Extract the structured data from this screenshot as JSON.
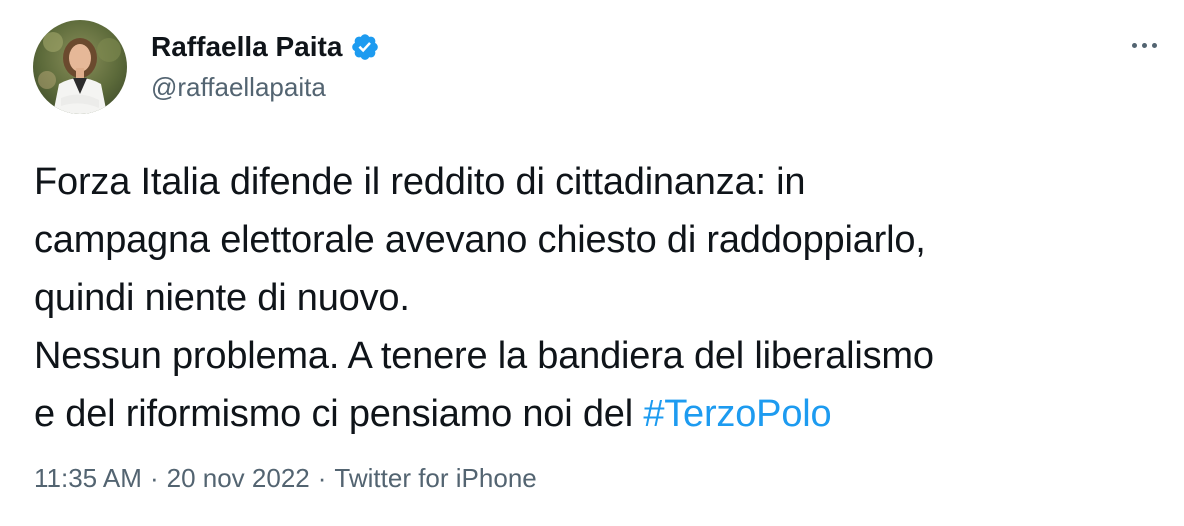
{
  "author": {
    "display_name": "Raffaella Paita",
    "handle": "@raffaellapaita",
    "verified_icon": "verified-badge-icon",
    "avatar_icon": "profile-photo"
  },
  "menu": {
    "more_icon": "more-options-icon"
  },
  "tweet": {
    "lines": [
      "Forza Italia difende il reddito di cittadinanza: in",
      "campagna elettorale avevano chiesto di raddoppiarlo,",
      "quindi niente di nuovo.",
      "Nessun problema. A tenere la bandiera del liberalismo"
    ],
    "last_line_text": "e del riformismo ci pensiamo noi del ",
    "hashtag": "#TerzoPolo"
  },
  "meta": {
    "time": "11:35 AM",
    "date": "20 nov 2022",
    "separator": "·",
    "source": "Twitter for iPhone"
  },
  "colors": {
    "text": "#0f1419",
    "secondary": "#536471",
    "link": "#1d9bf0",
    "verified": "#1d9bf0"
  }
}
